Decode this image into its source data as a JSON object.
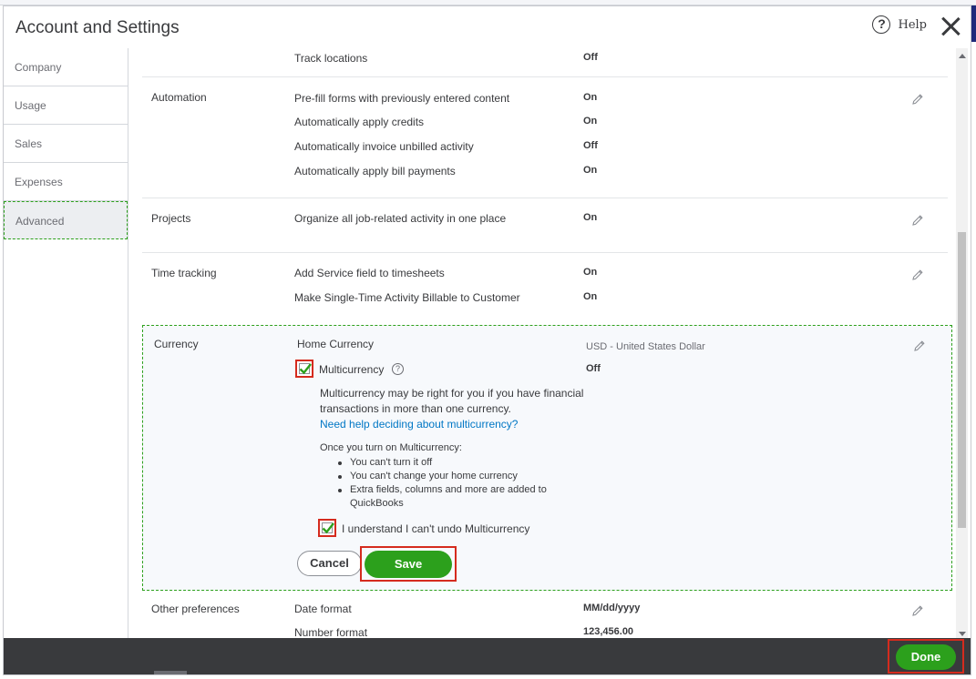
{
  "window": {
    "title": "Account and Settings",
    "help_label": "Help",
    "close_icon": "close-icon"
  },
  "sidebar": {
    "items": [
      {
        "label": "Company"
      },
      {
        "label": "Usage"
      },
      {
        "label": "Sales"
      },
      {
        "label": "Expenses"
      },
      {
        "label": "Advanced",
        "active": true
      }
    ]
  },
  "content": {
    "track_locations": {
      "label": "Track locations",
      "value": "Off"
    },
    "automation": {
      "title": "Automation",
      "rows": [
        {
          "label": "Pre-fill forms with previously entered content",
          "value": "On"
        },
        {
          "label": "Automatically apply credits",
          "value": "On"
        },
        {
          "label": "Automatically invoice unbilled activity",
          "value": "Off"
        },
        {
          "label": "Automatically apply bill payments",
          "value": "On"
        }
      ]
    },
    "projects": {
      "title": "Projects",
      "rows": [
        {
          "label": "Organize all job-related activity in one place",
          "value": "On"
        }
      ]
    },
    "time_tracking": {
      "title": "Time tracking",
      "rows": [
        {
          "label": "Add Service field to timesheets",
          "value": "On"
        },
        {
          "label": "Make Single-Time Activity Billable to Customer",
          "value": "On"
        }
      ]
    },
    "currency": {
      "title": "Currency",
      "home_currency_label": "Home Currency",
      "home_currency_value": "USD - United States Dollar",
      "multicurrency_label": "Multicurrency",
      "multicurrency_checked": true,
      "multicurrency_value": "Off",
      "info_text": "Multicurrency may be right for you if you have financial transactions in more than one currency.",
      "help_link": "Need help deciding about multicurrency?",
      "once_text": "Once you turn on Multicurrency:",
      "bullets": [
        "You can't turn it off",
        "You can't change your home currency",
        "Extra fields, columns and more are added to QuickBooks"
      ],
      "understand_label": "I understand I can't undo Multicurrency",
      "understand_checked": true,
      "cancel_label": "Cancel",
      "save_label": "Save"
    },
    "other_preferences": {
      "title": "Other preferences",
      "rows": [
        {
          "label": "Date format",
          "value": "MM/dd/yyyy"
        },
        {
          "label": "Number format",
          "value": "123,456.00"
        }
      ]
    }
  },
  "footer": {
    "done_label": "Done"
  },
  "colors": {
    "accent_green": "#2ca01c",
    "highlight_red": "#d52b1e",
    "link_blue": "#0077c5",
    "footer_dark": "#393a3d"
  }
}
